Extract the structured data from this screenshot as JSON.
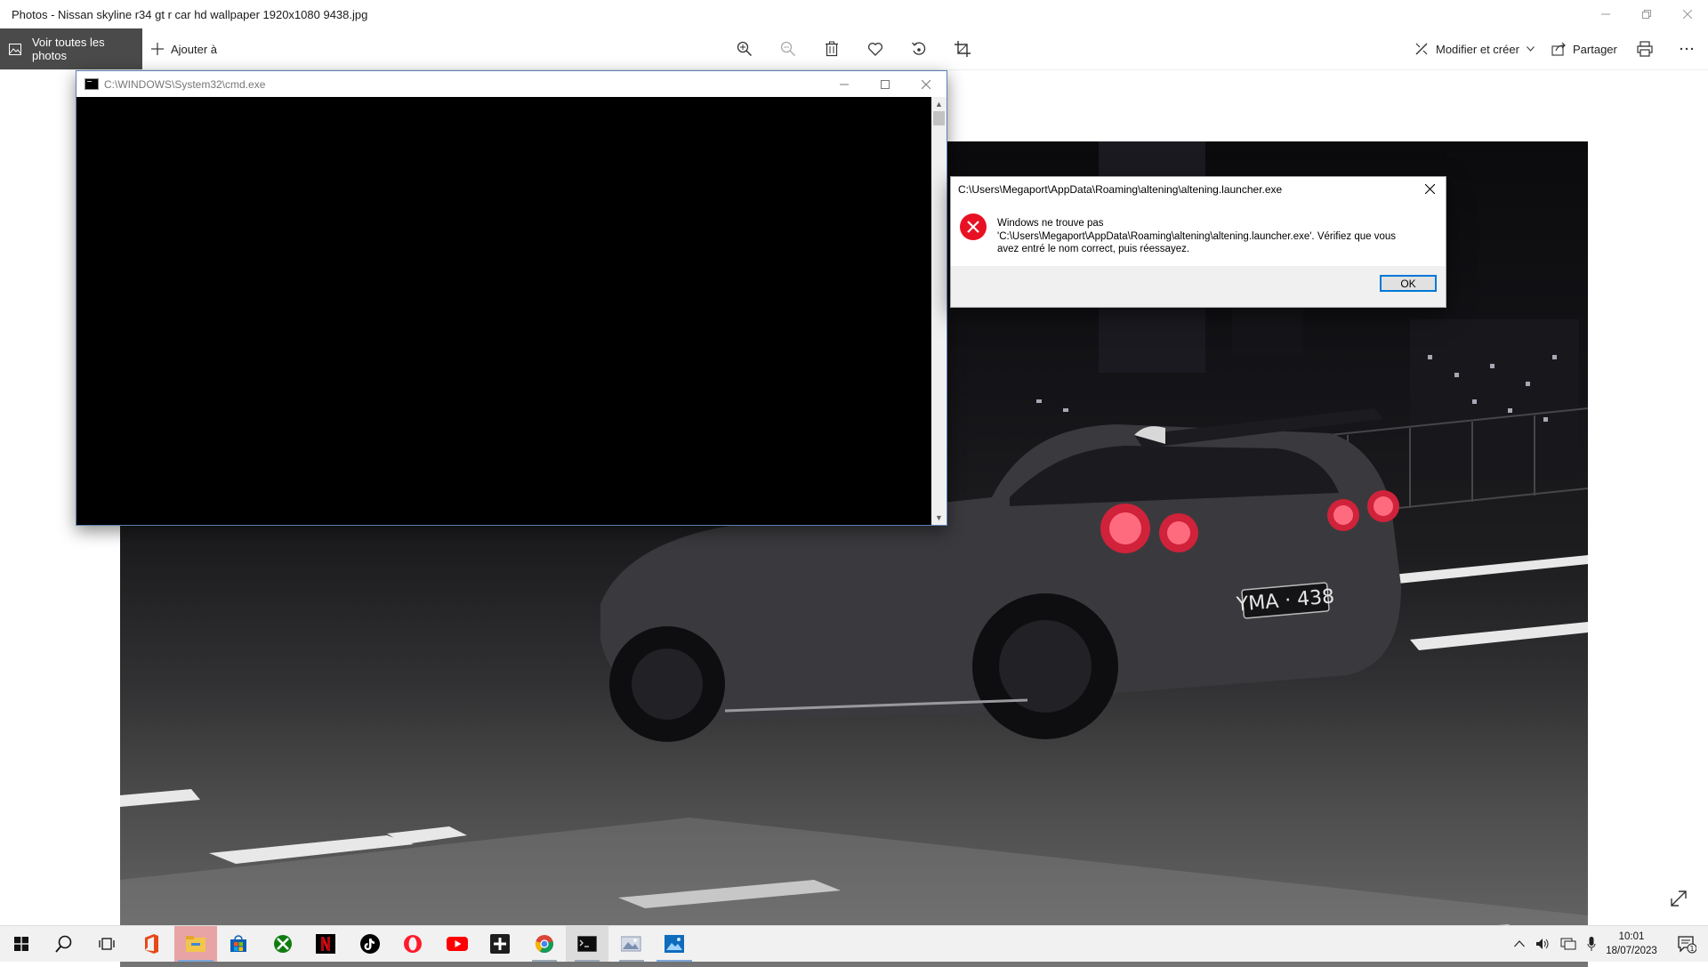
{
  "app": {
    "title": "Photos - Nissan skyline r34 gt r car hd wallpaper 1920x1080 9438.jpg",
    "window_controls": [
      "minimize-icon",
      "restore-icon",
      "close-icon"
    ]
  },
  "toolbar": {
    "all_photos_label": "Voir toutes les photos",
    "add_label": "Ajouter à",
    "tools": [
      "zoom-in-icon",
      "zoom-out-icon",
      "delete-icon",
      "favorite-icon",
      "rotate-icon",
      "crop-icon"
    ],
    "edit_label": "Modifier et créer",
    "share_label": "Partager",
    "print_icon": "print-icon",
    "more_icon": "more-icon"
  },
  "photo": {
    "plate_text": "YMA · 438"
  },
  "cmd": {
    "title": "C:\\WINDOWS\\System32\\cmd.exe"
  },
  "dialog": {
    "title": "C:\\Users\\Megaport\\AppData\\Roaming\\altening\\altening.launcher.exe",
    "message_line1": "Windows ne trouve pas",
    "message_line2": "'C:\\Users\\Megaport\\AppData\\Roaming\\altening\\altening.launcher.exe'. Vérifiez que vous",
    "message_line3": "avez entré le nom correct, puis réessayez.",
    "ok_label": "OK",
    "error_color": "#e81123"
  },
  "taskbar": {
    "items": [
      "start-icon",
      "search-icon",
      "task-view-icon",
      "office-icon",
      "file-explorer-icon",
      "store-icon",
      "xbox-icon",
      "netflix-icon",
      "tiktok-icon",
      "opera-icon",
      "youtube-icon",
      "app-plus-icon",
      "chrome-icon",
      "cmd-icon",
      "photo-viewer-icon",
      "photos-icon"
    ],
    "time": "10:01",
    "date": "18/07/2023",
    "notification_count": "1"
  }
}
